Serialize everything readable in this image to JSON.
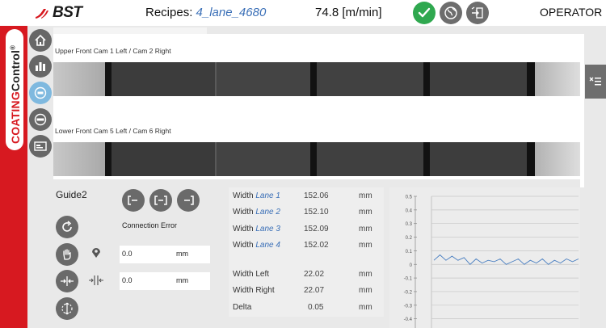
{
  "header": {
    "brand": "BST",
    "recipes_label": "Recipes: ",
    "recipe_name": "4_lane_4680",
    "speed": "74.8 [m/min]",
    "role": "OPERATOR"
  },
  "sidebar": {
    "brand_part1": "COATING",
    "brand_part2": "Control",
    "brand_reg": "®",
    "items": [
      {
        "name": "home"
      },
      {
        "name": "statistics"
      },
      {
        "name": "edit-active"
      },
      {
        "name": "cls"
      },
      {
        "name": "card-reader"
      }
    ]
  },
  "cameras": {
    "upper_label": "Upper Front Cam 1 Left / Cam 2 Right",
    "lower_label": "Lower Front Cam 5 Left / Cam 6 Right"
  },
  "guide": {
    "title": "Guide2",
    "connection_status": "Connection Error",
    "field1_value": "0.0",
    "field1_unit": "mm",
    "field2_value": "0.0",
    "field2_unit": "mm"
  },
  "widths": {
    "rows": [
      {
        "prefix": "Width ",
        "lane": "Lane 1",
        "value": "152.06",
        "unit": "mm"
      },
      {
        "prefix": "Width ",
        "lane": "Lane 2",
        "value": "152.10",
        "unit": "mm"
      },
      {
        "prefix": "Width ",
        "lane": "Lane 3",
        "value": "152.09",
        "unit": "mm"
      },
      {
        "prefix": "Width ",
        "lane": "Lane 4",
        "value": "152.02",
        "unit": "mm"
      }
    ],
    "summary": [
      {
        "label": "Width Left",
        "value": "22.02",
        "unit": "mm"
      },
      {
        "label": "Width Right",
        "value": "22.07",
        "unit": "mm"
      },
      {
        "label": "Delta",
        "value": "0.05",
        "unit": "mm"
      }
    ]
  },
  "chart_data": {
    "type": "line",
    "yticks": [
      "0.5",
      "0.4",
      "0.3",
      "0.2",
      "0.1",
      "0",
      "-0.1",
      "-0.2",
      "-0.3",
      "-0.4"
    ],
    "ylim": [
      -0.45,
      0.5
    ],
    "series": [
      {
        "values": [
          0.03,
          0.07,
          0.03,
          0.06,
          0.03,
          0.05,
          0.0,
          0.04,
          0.01,
          0.03,
          0.02,
          0.04,
          0.0,
          0.02,
          0.04,
          0.0,
          0.03,
          0.01,
          0.04,
          0.0,
          0.03,
          0.01,
          0.04,
          0.02,
          0.04
        ],
        "color": "#4a7fc1"
      }
    ],
    "grid": true
  },
  "colors": {
    "brand_red": "#d71920",
    "ok_green": "#2fa84f",
    "button_gray": "#676767",
    "active_blue": "#7fb9df",
    "lane_blue": "#3a6fb7"
  }
}
